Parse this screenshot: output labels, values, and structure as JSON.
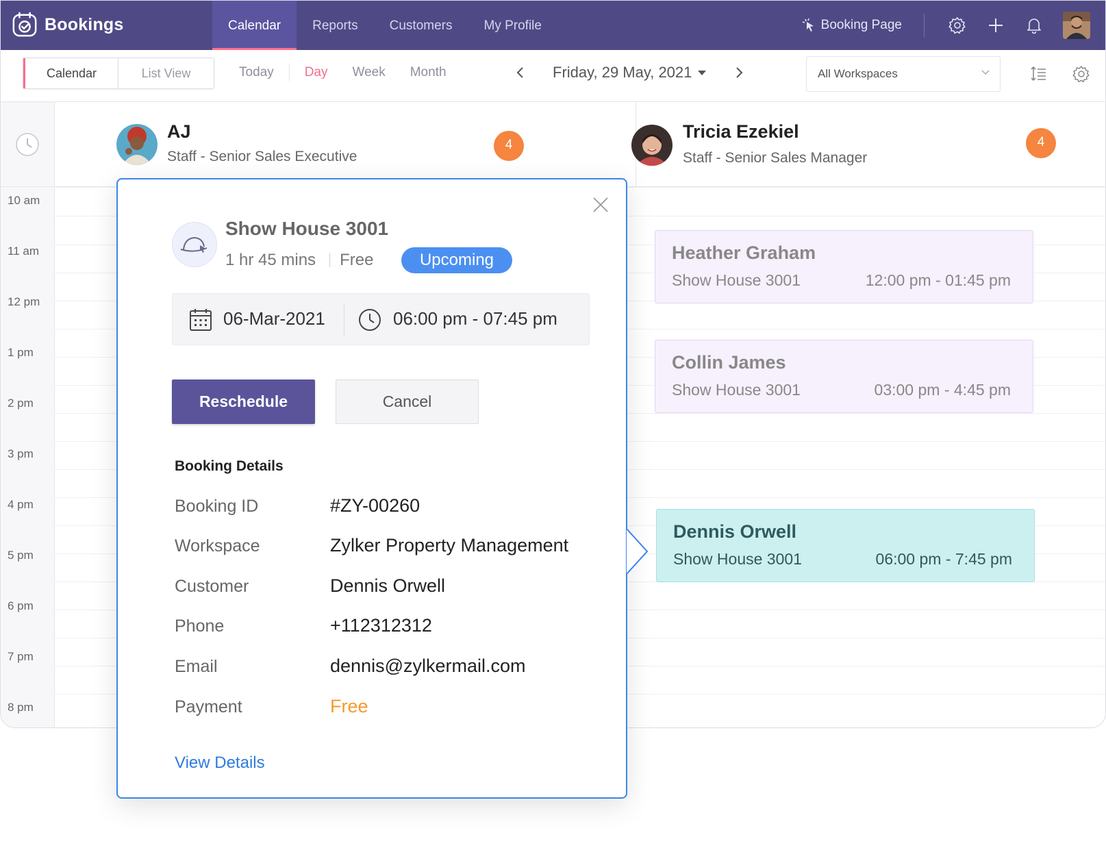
{
  "app": {
    "name": "Bookings",
    "nav_tabs": [
      {
        "label": "Calendar",
        "active": true
      },
      {
        "label": "Reports",
        "active": false
      },
      {
        "label": "Customers",
        "active": false
      },
      {
        "label": "My Profile",
        "active": false
      }
    ],
    "booking_page_label": "Booking Page",
    "icons": [
      "settings-icon",
      "plus-icon",
      "bell-icon"
    ]
  },
  "toolbar": {
    "segments": [
      "Calendar",
      "List View"
    ],
    "today": "Today",
    "views": [
      "Day",
      "Week",
      "Month"
    ],
    "active_view": "Day",
    "date_label": "Friday, 29 May, 2021",
    "workspace_select": "All Workspaces"
  },
  "times": [
    "10 am",
    "11 am",
    "12 pm",
    "1 pm",
    "2 pm",
    "3 pm",
    "4 pm",
    "5 pm",
    "6 pm",
    "7 pm",
    "8 pm"
  ],
  "staff": [
    {
      "name": "AJ",
      "role": "Staff - Senior Sales Executive",
      "count": "4"
    },
    {
      "name": "Tricia Ezekiel",
      "role": "Staff - Senior Sales Manager",
      "count": "4"
    }
  ],
  "events": [
    {
      "customer": "Heather Graham",
      "service": "Show House 3001",
      "time": "12:00 pm - 01:45 pm"
    },
    {
      "customer": "Collin James",
      "service": "Show House 3001",
      "time": "03:00 pm - 4:45 pm"
    },
    {
      "customer": "Dennis Orwell",
      "service": "Show House 3001",
      "time": "06:00 pm - 7:45 pm"
    }
  ],
  "popup": {
    "service_name": "Show House 3001",
    "duration": "1 hr 45 mins",
    "price": "Free",
    "status": "Upcoming",
    "date": "06-Mar-2021",
    "time": "06:00 pm - 07:45 pm",
    "reschedule_label": "Reschedule",
    "cancel_label": "Cancel",
    "details_title": "Booking Details",
    "details": [
      {
        "label": "Booking ID",
        "value": "#ZY-00260"
      },
      {
        "label": "Workspace",
        "value": "Zylker Property Management"
      },
      {
        "label": "Customer",
        "value": "Dennis Orwell"
      },
      {
        "label": "Phone",
        "value": "+112312312"
      },
      {
        "label": "Email",
        "value": "dennis@zylkermail.com"
      },
      {
        "label": "Payment",
        "value": "Free"
      }
    ],
    "view_details_label": "View Details"
  },
  "colors": {
    "nav_bg": "#4f4a85",
    "accent_pink": "#ff6f8c",
    "badge_orange": "#f5853f",
    "status_blue": "#4b90f1",
    "primary_button": "#5b549b",
    "selected_event": "#ccf0f0",
    "payment_free": "#f59a2c"
  }
}
